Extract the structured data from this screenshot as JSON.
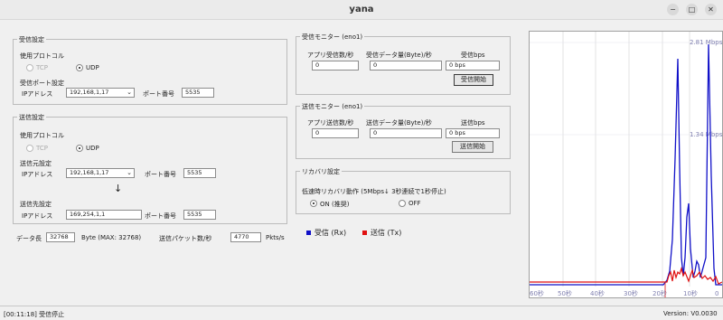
{
  "window": {
    "title": "yana",
    "minimize": "−",
    "maximize": "□",
    "close": "✕"
  },
  "recv_settings": {
    "title": "受信設定",
    "protocol_label": "使用プロトコル",
    "tcp": "TCP",
    "udp": "UDP",
    "selected": "UDP",
    "port_section": "受信ポート設定",
    "ip_label": "IPアドレス",
    "ip_value": "192,168,1,17",
    "port_label": "ポート番号",
    "port_value": "5535"
  },
  "send_settings": {
    "title": "送信設定",
    "protocol_label": "使用プロトコル",
    "tcp": "TCP",
    "udp": "UDP",
    "selected": "UDP",
    "src_section": "送信元設定",
    "src_ip_label": "IPアドレス",
    "src_ip_value": "192,168,1,17",
    "src_port_label": "ポート番号",
    "src_port_value": "5535",
    "arrow": "↓",
    "dst_section": "送信先設定",
    "dst_ip_label": "IPアドレス",
    "dst_ip_value": "169,254,1,1",
    "dst_port_label": "ポート番号",
    "dst_port_value": "5535"
  },
  "data_len": {
    "label": "データ長",
    "value": "32768",
    "unit": "Byte (MAX: 32768)"
  },
  "packets": {
    "label": "送信パケット数/秒",
    "value": "4770",
    "unit": "Pkts/s"
  },
  "recv_monitor": {
    "title": "受信モニター (eno1)",
    "col1": "アプリ受信数/秒",
    "col2": "受信データ量(Byte)/秒",
    "col3": "受信bps",
    "val1": "0",
    "val2": "0",
    "val3": "0 bps",
    "button": "受信開始"
  },
  "send_monitor": {
    "title": "送信モニター (eno1)",
    "col1": "アプリ送信数/秒",
    "col2": "送信データ量(Byte)/秒",
    "col3": "送信bps",
    "val1": "0",
    "val2": "0",
    "val3": "0 bps",
    "button": "送信開始"
  },
  "recovery": {
    "title": "リカバリ設定",
    "desc": "低速時リカバリ動作 (5Mbps↓ 3秒連続で1秒停止)",
    "on": "ON (推奨)",
    "off": "OFF",
    "selected": "ON"
  },
  "legend": {
    "rx": "受信 (Rx)",
    "tx": "送信 (Tx)",
    "rx_color": "#1010c8",
    "tx_color": "#e01010"
  },
  "graph": {
    "y_label_top": "2.81 Mbps",
    "y_label_mid": "1.34 Mbps",
    "x_labels": [
      "60秒",
      "50秒",
      "40秒",
      "30秒",
      "20秒",
      "10秒",
      "0"
    ]
  },
  "status": {
    "message": "[00:11:18] 受信停止",
    "version": "Version: V0.0030"
  }
}
